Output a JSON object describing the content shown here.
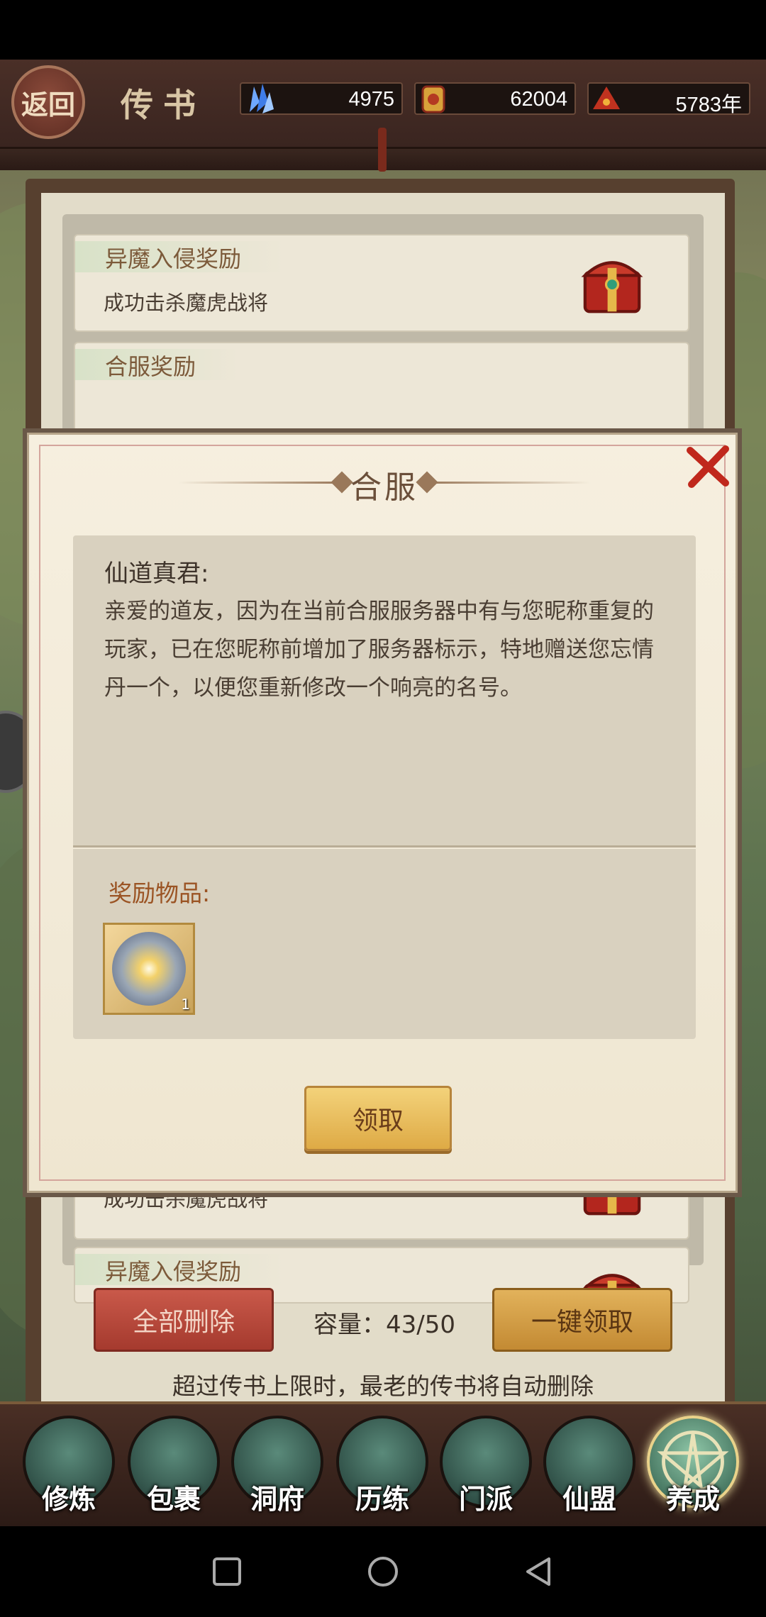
{
  "header": {
    "back_label": "返回",
    "title": "传书",
    "resources": [
      {
        "icon": "crystal-icon",
        "value": "4975"
      },
      {
        "icon": "gold-ingot-icon",
        "value": "62004"
      },
      {
        "icon": "lifespan-icon",
        "value": "5783年"
      }
    ]
  },
  "mail_list": [
    {
      "tag": "异魔入侵奖励",
      "desc": "成功击杀魔虎战将"
    },
    {
      "tag": "合服奖励",
      "desc": ""
    },
    {
      "tag": "",
      "desc": "成功击杀魔虎战将"
    },
    {
      "tag": "异魔入侵奖励",
      "desc": "成功击杀魔虎战将"
    }
  ],
  "actions": {
    "delete_all": "全部删除",
    "capacity": "容量：43/50",
    "claim_all": "一键领取",
    "limit_note": "超过传书上限时，最老的传书将自动删除"
  },
  "bottom_nav": [
    {
      "label": "修炼",
      "icon": "cultivate-icon"
    },
    {
      "label": "包裹",
      "icon": "bag-icon"
    },
    {
      "label": "洞府",
      "icon": "cave-icon"
    },
    {
      "label": "历练",
      "icon": "scroll-icon"
    },
    {
      "label": "门派",
      "icon": "sect-icon"
    },
    {
      "label": "仙盟",
      "icon": "alliance-icon"
    },
    {
      "label": "养成",
      "icon": "pentagram-icon"
    }
  ],
  "modal": {
    "title": "合服",
    "sender": "仙道真君:",
    "body": "亲爱的道友，因为在当前合服服务器中有与您昵称重复的玩家，已在您昵称前增加了服务器标示，特地赠送您忘情丹一个，以便您重新修改一个响亮的名号。",
    "reward_label": "奖励物品:",
    "reward_item": {
      "icon": "forget-pill-orb-icon",
      "count": "1"
    },
    "claim_label": "领取"
  },
  "colors": {
    "accent_red": "#c9594a",
    "accent_gold": "#deaa45",
    "reward_label": "#9b5424"
  }
}
